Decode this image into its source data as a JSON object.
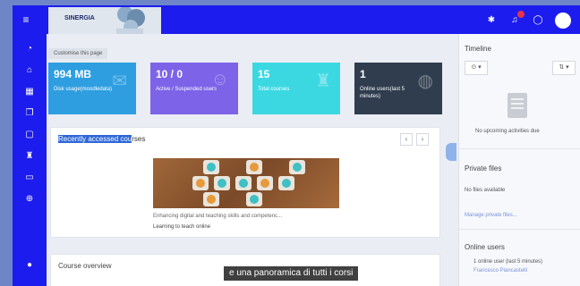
{
  "header": {
    "logo_text": "SINERGIA",
    "icons": [
      "bell-icon",
      "chat-icon",
      "settings-icon"
    ]
  },
  "sidebar": {
    "icons": [
      "dashboard-icon",
      "home-icon",
      "calendar-icon",
      "files-icon",
      "lock-icon",
      "graduation-icon",
      "folder-icon",
      "plus-icon",
      "settings-icon"
    ]
  },
  "main": {
    "customise_label": "Customise this page",
    "stats": [
      {
        "value": "994 MB",
        "label": "Disk usage(moodledata)",
        "color": "#2e9ee0"
      },
      {
        "value": "10 / 0",
        "label": "Active / Suspended users",
        "color": "#7c63e8"
      },
      {
        "value": "15",
        "label": "Total courses",
        "color": "#3cd8e2"
      },
      {
        "value": "1",
        "label": "Online users(last 5 minutes)",
        "color": "#2f3d4e"
      }
    ],
    "recent": {
      "title_highlight": "Recently accessed cou",
      "title_rest": "rses",
      "prev": "‹",
      "next": "›",
      "course_desc": "Enhancing digital and teaching skills and competenc...",
      "course_category": "Learning to teach online"
    },
    "overview_title": "Course overview"
  },
  "drawer": {
    "timeline_title": "Timeline",
    "timeline_filter": "⊙ ▾",
    "timeline_sort": "⇅ ▾",
    "no_activities": "No upcoming activities due",
    "private_files_title": "Private files",
    "no_files": "No files available",
    "manage_files": "Manage private files...",
    "online_users_title": "Online users",
    "online_count": "1 online user (last 5 minutes)",
    "online_user_name": "Francesco Piancastelli"
  },
  "subtitle": "e una panoramica di tutti i corsi"
}
